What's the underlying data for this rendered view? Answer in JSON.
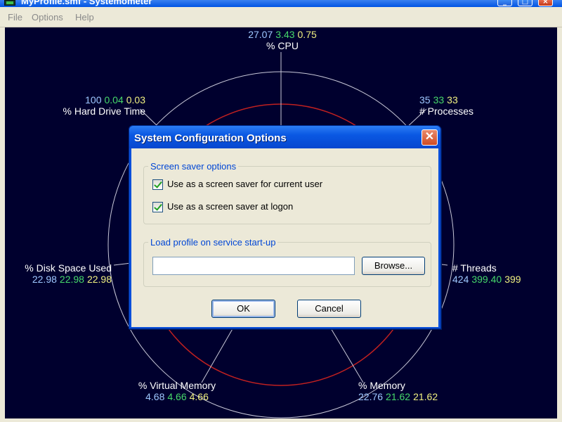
{
  "window": {
    "title": "MyProfile.smf - Systemometer",
    "minimize_glyph": "_",
    "maximize_glyph": "□",
    "close_glyph": "×"
  },
  "menu": {
    "items": [
      {
        "label": "File"
      },
      {
        "label": "Options"
      },
      {
        "label": "Help"
      }
    ]
  },
  "colors": {
    "canvas_bg": "#00002e",
    "axis_line": "#c8c8d8",
    "threshold_ring": "#c02020",
    "current_value": "#9fc8ff",
    "average_value": "#46d96a",
    "max_value": "#f0f080"
  },
  "metrics": [
    {
      "key": "cpu",
      "label": "% CPU",
      "current": "27.07",
      "average": "3.43",
      "max": "0.75"
    },
    {
      "key": "processes",
      "label": "# Processes",
      "current": "35",
      "average": "33",
      "max": "33"
    },
    {
      "key": "threads",
      "label": "# Threads",
      "current": "424",
      "average": "399.40",
      "max": "399"
    },
    {
      "key": "memory",
      "label": "% Memory",
      "current": "22.76",
      "average": "21.62",
      "max": "21.62"
    },
    {
      "key": "virtual_memory",
      "label": "% Virtual Memory",
      "current": "4.68",
      "average": "4.66",
      "max": "4.66"
    },
    {
      "key": "disk_space",
      "label": "% Disk Space Used",
      "current": "22.98",
      "average": "22.98",
      "max": "22.98"
    },
    {
      "key": "hard_drive_time",
      "label": "% Hard Drive Time",
      "current": "100",
      "average": "0.04",
      "max": "0.03"
    }
  ],
  "dialog": {
    "title": "System Configuration Options",
    "close_glyph": "✕",
    "screensaver_group": {
      "legend": "Screen saver options",
      "options": [
        {
          "label": "Use as a screen saver for current user",
          "checked": true
        },
        {
          "label": "Use as a screen saver at logon",
          "checked": true
        }
      ]
    },
    "profile_group": {
      "legend": "Load profile on service start-up",
      "path_value": "",
      "browse_label": "Browse..."
    },
    "ok_label": "OK",
    "cancel_label": "Cancel"
  }
}
